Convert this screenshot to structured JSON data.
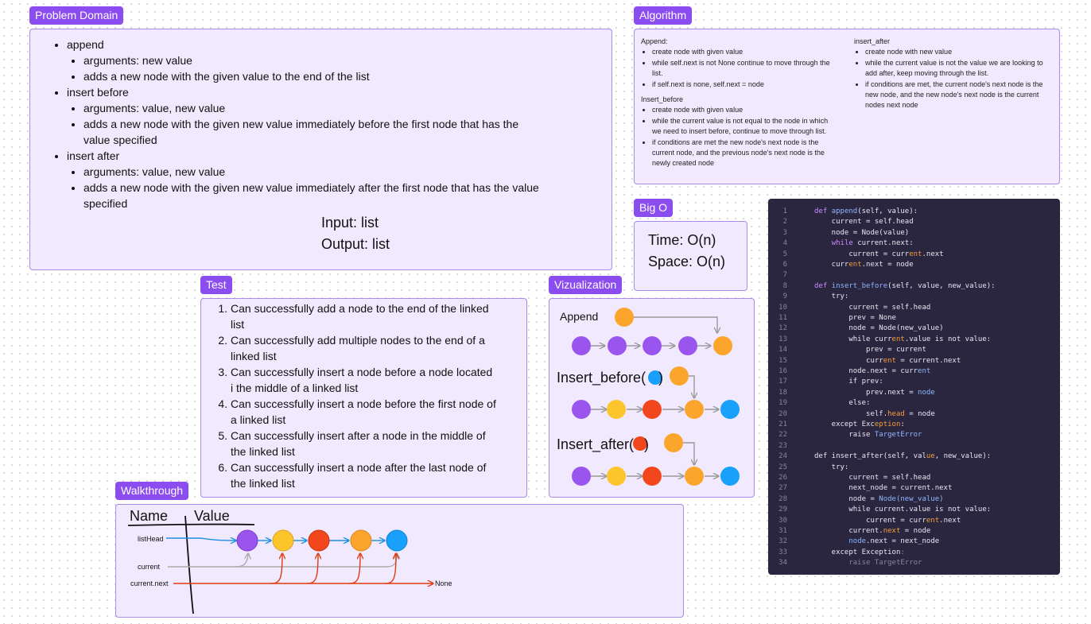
{
  "problem_domain": {
    "tag": "Problem Domain",
    "items": [
      {
        "label": "append",
        "subs": [
          "arguments: new value",
          "adds a new node with the given value to the end of the list"
        ]
      },
      {
        "label": "insert before",
        "subs": [
          "arguments: value, new value",
          "adds a new node with the given new value immediately before the first node that has the value specified"
        ]
      },
      {
        "label": "insert after",
        "subs": [
          "arguments: value, new value",
          "adds a new node with the given new value immediately after the first node that has the value specified"
        ]
      }
    ],
    "input": "Input: list",
    "output": "Output: list"
  },
  "algorithm": {
    "tag": "Algorithm",
    "append_title": "Append:",
    "append_steps": [
      "create node with given value",
      "while self.next is not None continue to move through the list.",
      "if self.next is none, self.next = node"
    ],
    "insert_before_title": "Insert_before",
    "insert_before_steps": [
      "create node with given value",
      "while the current value is not equal to the node in which we need to insert before, continue to move through list.",
      "if conditions are met the new node's next node is the current node, and the previous node's next node is the newly created node"
    ],
    "insert_after_title": "insert_after",
    "insert_after_steps": [
      "create node with new value",
      "while the current value is not the value we are looking to add after, keep moving through the list.",
      "if conditions are met, the current node's next node is the new node, and the new node's next node is the current nodes next node"
    ]
  },
  "big_o": {
    "tag": "Big O",
    "time": "Time: O(n)",
    "space": "Space: O(n)"
  },
  "test": {
    "tag": "Test",
    "items": [
      "Can successfully add a node to the end of the linked list",
      "Can successfully add multiple nodes to the end of a linked list",
      "Can successfully insert a node before a node located i the middle of a linked list",
      "Can successfully insert a node before the first node of a linked list",
      "Can successfully insert after a node in the middle of the linked list",
      "Can successfully insert a node after the last node of the linked list"
    ]
  },
  "visualization": {
    "tag": "Vizualization",
    "append_label": "Append",
    "insert_before_label": "Insert_before(",
    "insert_before_close": ")",
    "insert_after_label": "Insert_after(",
    "insert_after_close": ")"
  },
  "walkthrough": {
    "tag": "Walkthrough",
    "col_name": "Name",
    "col_value": "Value",
    "rows": [
      "listHead",
      "current",
      "current.next"
    ],
    "none_label": "None"
  },
  "colors": {
    "purple": "#9a55ee",
    "yellow": "#fcc52b",
    "red": "#f2471c",
    "orange": "#fca52c",
    "blue": "#18a0fb",
    "tag_bg": "#8b4cf0",
    "panel_bg": "#f1e9fd",
    "code_bg": "#2b2640"
  },
  "code": {
    "lines": [
      [
        [
          "def ",
          "kw"
        ],
        [
          "append",
          "fn"
        ],
        [
          "(self, value):",
          ""
        ]
      ],
      [
        [
          "    current = self.head",
          ""
        ]
      ],
      [
        [
          "    node = Node(value)",
          ""
        ]
      ],
      [
        [
          "    ",
          ""
        ],
        [
          "while",
          "kw"
        ],
        [
          " curr",
          ""
        ],
        [
          "ent",
          ""
        ],
        [
          ".next:",
          ""
        ]
      ],
      [
        [
          "        current = curr",
          ""
        ],
        [
          "ent",
          "hl"
        ],
        [
          ".next",
          ""
        ]
      ],
      [
        [
          "    curr",
          ""
        ],
        [
          "ent",
          "hl"
        ],
        [
          ".next = node",
          ""
        ]
      ],
      [
        [
          "",
          ""
        ]
      ],
      [
        [
          "def ",
          "kw"
        ],
        [
          "insert_before",
          "fn"
        ],
        [
          "(self, value, new_value):",
          ""
        ]
      ],
      [
        [
          "    try:",
          ""
        ]
      ],
      [
        [
          "        current = self.head",
          ""
        ]
      ],
      [
        [
          "        prev = None",
          ""
        ]
      ],
      [
        [
          "        node = Node(new_value)",
          ""
        ]
      ],
      [
        [
          "        while curr",
          ""
        ],
        [
          "ent",
          "hl"
        ],
        [
          ".value is not value:",
          ""
        ]
      ],
      [
        [
          "            prev = current",
          ""
        ]
      ],
      [
        [
          "            curr",
          ""
        ],
        [
          "ent",
          "hl"
        ],
        [
          " = current.next",
          ""
        ]
      ],
      [
        [
          "        node.next = curr",
          ""
        ],
        [
          "ent",
          "fn"
        ]
      ],
      [
        [
          "        if prev:",
          ""
        ]
      ],
      [
        [
          "            prev.next = ",
          ""
        ],
        [
          "node",
          "fn"
        ]
      ],
      [
        [
          "        else:",
          ""
        ]
      ],
      [
        [
          "            self.",
          ""
        ],
        [
          "head",
          "hl"
        ],
        [
          " = node",
          ""
        ]
      ],
      [
        [
          "    except Exc",
          ""
        ],
        [
          "eption",
          "hl"
        ],
        [
          ":",
          ""
        ]
      ],
      [
        [
          "        raise ",
          ""
        ],
        [
          "TargetError",
          "fn"
        ]
      ],
      [
        [
          "",
          ""
        ]
      ],
      [
        [
          "def insert_after(self, val",
          ""
        ],
        [
          "ue",
          "hl"
        ],
        [
          ", new_value):",
          ""
        ]
      ],
      [
        [
          "    try:",
          ""
        ]
      ],
      [
        [
          "        current = self.head",
          ""
        ]
      ],
      [
        [
          "        next_node = current.next",
          ""
        ]
      ],
      [
        [
          "        node = ",
          ""
        ],
        [
          "Node(new_value)",
          "fn"
        ]
      ],
      [
        [
          "        while current.value is not value:",
          ""
        ]
      ],
      [
        [
          "            current = curr",
          ""
        ],
        [
          "ent",
          "hl"
        ],
        [
          ".next",
          ""
        ]
      ],
      [
        [
          "        current.",
          ""
        ],
        [
          "next",
          "hl"
        ],
        [
          " = node",
          ""
        ]
      ],
      [
        [
          "        ",
          ""
        ],
        [
          "node",
          "fn"
        ],
        [
          ".next = next_node",
          ""
        ]
      ],
      [
        [
          "    except Exception",
          ""
        ],
        [
          ":",
          "dim"
        ]
      ],
      [
        [
          "        raise TargetError",
          "dim"
        ]
      ]
    ]
  }
}
